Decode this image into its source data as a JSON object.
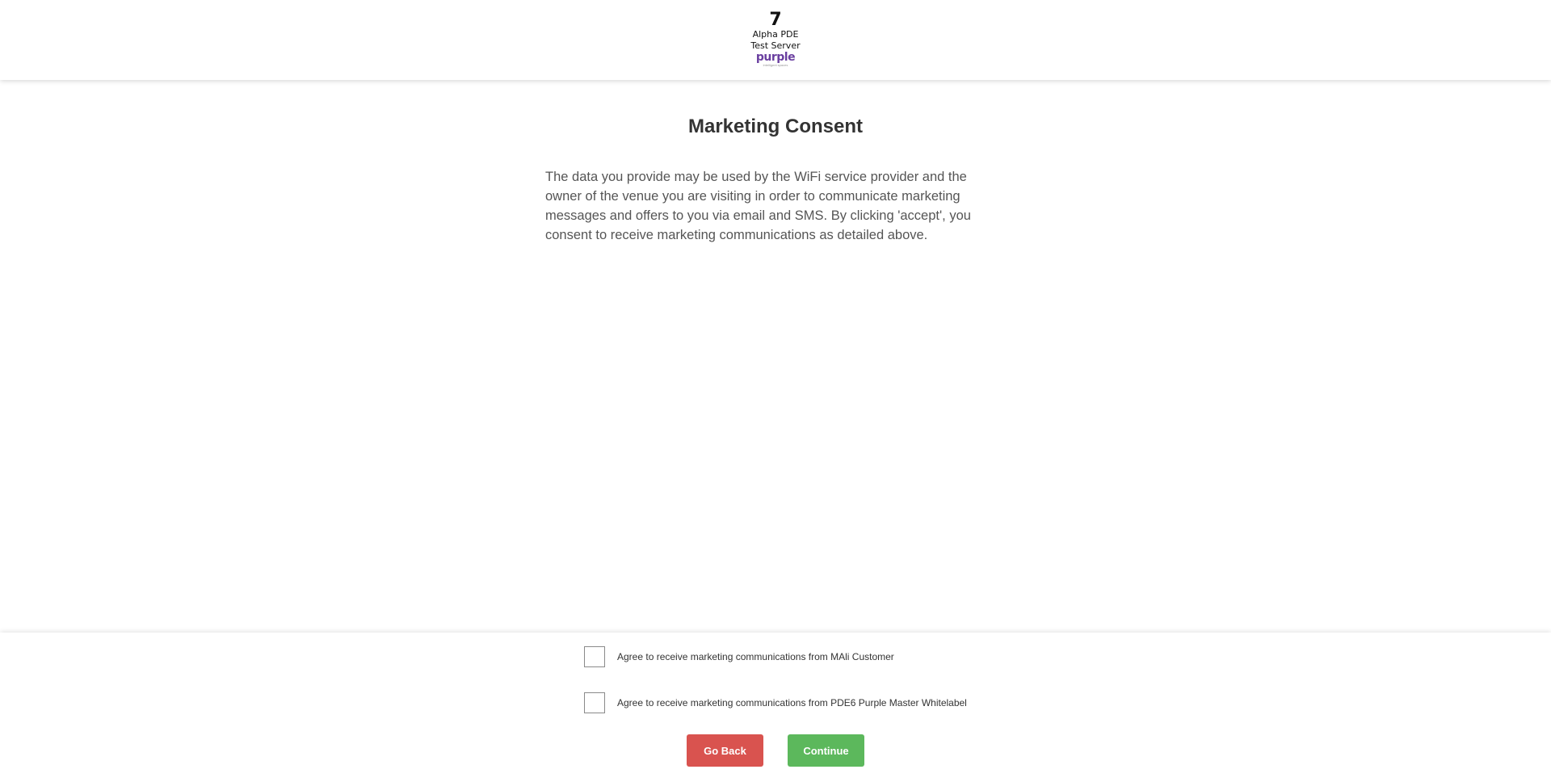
{
  "header": {
    "logo": {
      "number": "7",
      "line1": "Alpha PDE",
      "line2": "Test Server",
      "brand": "purple",
      "tagline": "intelligent spaces"
    }
  },
  "main": {
    "title": "Marketing Consent",
    "description": "The data you provide may be used by the WiFi service provider and the owner of the venue you are visiting in order to communicate marketing messages and offers to you via email and SMS. By clicking 'accept', you consent to receive marketing communications as detailed above."
  },
  "consents": [
    {
      "label": "Agree to receive marketing communications from MAli Customer",
      "checked": false
    },
    {
      "label": "Agree to receive marketing communications from PDE6 Purple Master Whitelabel",
      "checked": false
    }
  ],
  "actions": {
    "back_label": "Go Back",
    "continue_label": "Continue"
  },
  "colors": {
    "back_button": "#d9534f",
    "continue_button": "#5cb85c",
    "brand": "#6a3fa0"
  }
}
